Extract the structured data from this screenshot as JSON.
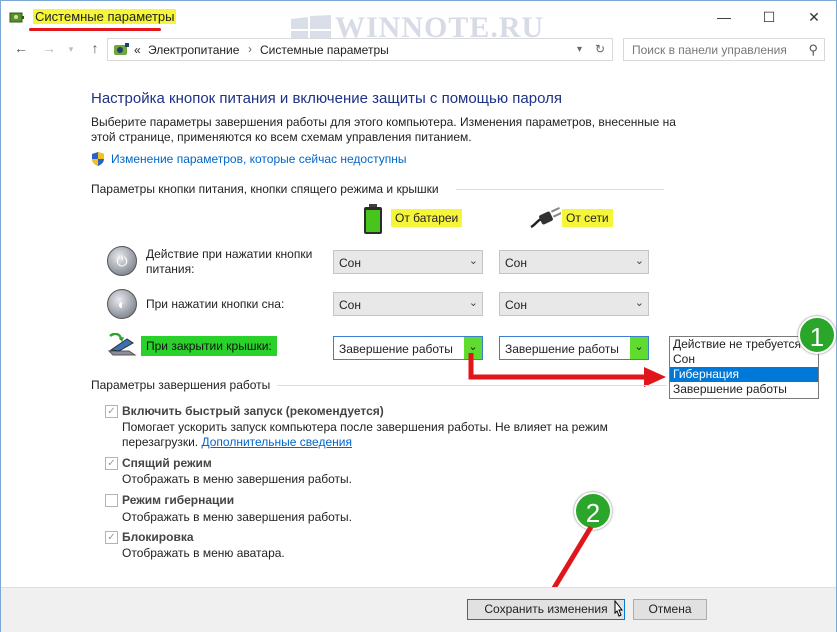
{
  "window": {
    "title": "Системные параметры",
    "watermark": "WINNOTE.RU",
    "minimize": "—",
    "maximize": "☐",
    "close": "✕"
  },
  "address": {
    "back": "←",
    "forward": "→",
    "up": "↑",
    "prefix": "«",
    "crumbs": [
      "Электропитание",
      "Системные параметры"
    ],
    "search_placeholder": "Поиск в панели управления"
  },
  "main": {
    "heading": "Настройка кнопок питания и включение защиты с помощью пароля",
    "description": "Выберите параметры завершения работы для этого компьютера. Изменения параметров, внесенные на этой странице, применяются ко всем схемам управления питанием.",
    "change_link": "Изменение параметров, которые сейчас недоступны",
    "section_buttons": "Параметры кнопки питания, кнопки спящего режима и крышки",
    "col_battery": "От батареи",
    "col_power": "От сети",
    "rows": [
      {
        "label": "Действие при нажатии кнопки питания:",
        "battery": "Сон",
        "power": "Сон"
      },
      {
        "label": "При нажатии кнопки сна:",
        "battery": "Сон",
        "power": "Сон"
      },
      {
        "label": "При закрытии крышки:",
        "battery": "Завершение работы",
        "power": "Завершение работы"
      }
    ],
    "dropdown_options": [
      "Действие не требуется",
      "Сон",
      "Гибернация",
      "Завершение работы"
    ],
    "dropdown_highlighted": "Гибернация",
    "section_shutdown": "Параметры завершения работы",
    "options": [
      {
        "label": "Включить быстрый запуск (рекомендуется)",
        "checked": true,
        "desc1": "Помогает ускорить запуск компьютера после завершения работы. Не влияет на режим",
        "desc2": "перезагрузки.",
        "link": "Дополнительные сведения"
      },
      {
        "label": "Спящий режим",
        "checked": true,
        "desc1": "Отображать в меню завершения работы."
      },
      {
        "label": "Режим гибернации",
        "checked": false,
        "desc1": "Отображать в меню завершения работы."
      },
      {
        "label": "Блокировка",
        "checked": true,
        "desc1": "Отображать в меню аватара."
      }
    ]
  },
  "annotations": {
    "badge1": "1",
    "badge2": "2"
  },
  "buttons": {
    "save": "Сохранить изменения",
    "cancel": "Отмена"
  },
  "colors": {
    "highlight_yellow": "#f5f53a",
    "highlight_green": "#2bd12b",
    "annotation_red": "#e0161b",
    "badge_green": "#2aa62a",
    "selection_blue": "#0078d7"
  }
}
